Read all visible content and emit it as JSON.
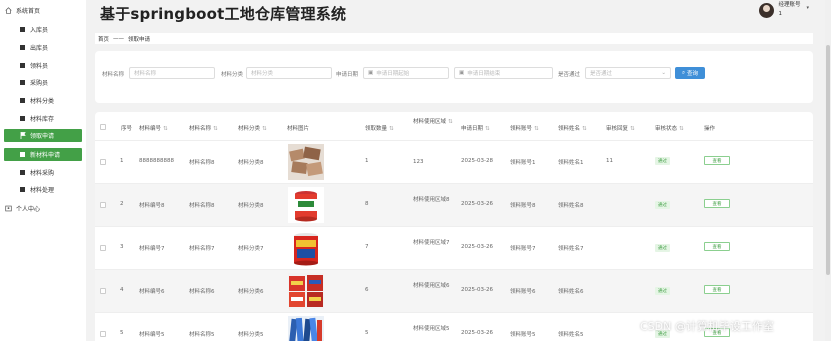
{
  "sidebar": {
    "items": [
      {
        "label": "系统首页",
        "icon": "home-icon",
        "type": "top"
      },
      {
        "label": "入库员",
        "icon": "square-icon",
        "type": "sub"
      },
      {
        "label": "出库员",
        "icon": "square-icon",
        "type": "sub"
      },
      {
        "label": "领料员",
        "icon": "square-icon",
        "type": "sub"
      },
      {
        "label": "采购员",
        "icon": "square-icon",
        "type": "sub"
      },
      {
        "label": "材料分类",
        "icon": "square-icon",
        "type": "sub"
      },
      {
        "label": "材料库存",
        "icon": "square-icon",
        "type": "sub"
      },
      {
        "label": "领取申请",
        "icon": "flag-icon",
        "type": "active"
      },
      {
        "label": "新材料申请",
        "icon": "square-icon",
        "type": "active"
      },
      {
        "label": "材料采购",
        "icon": "square-icon",
        "type": "sub"
      },
      {
        "label": "材料处理",
        "icon": "square-icon",
        "type": "sub"
      },
      {
        "label": "个人中心",
        "icon": "user-icon",
        "type": "top"
      }
    ]
  },
  "header": {
    "title": "基于springboot工地仓库管理系统",
    "user_name": "经理账号",
    "user_sub": "1"
  },
  "breadcrumb": {
    "home": "首页",
    "sep": "——",
    "current": "领取申请"
  },
  "filters": {
    "material_name_label": "材料名称",
    "material_name_placeholder": "材料名称",
    "category_label": "材料分类",
    "category_placeholder": "材料分类",
    "date_label": "申请日期",
    "date_start_placeholder": "申请日期起始",
    "date_end_placeholder": "申请日期结束",
    "pass_label": "是否通过",
    "pass_placeholder": "是否通过",
    "search_label": "查询"
  },
  "table": {
    "headers": [
      "序号",
      "材料编号",
      "材料名称",
      "材料分类",
      "材料图片",
      "领取数量",
      "材料使用区域",
      "申请日期",
      "领料账号",
      "领料姓名",
      "审核回复",
      "审核状态",
      "操作"
    ],
    "rows": [
      {
        "idx": "1",
        "code": "8888888888",
        "name": "材料名称8",
        "cat": "材料分类8",
        "qty": "1",
        "area": "123",
        "date": "2025-03-28",
        "acct": "领料账号1",
        "person": "领料姓名1",
        "reply": "11",
        "status": "通过",
        "action": "查看",
        "img": "tiles"
      },
      {
        "idx": "2",
        "code": "材料编号8",
        "name": "材料名称8",
        "cat": "材料分类8",
        "qty": "8",
        "area": "材料使用区域8",
        "date": "2025-03-26",
        "acct": "领料账号8",
        "person": "领料姓名8",
        "reply": "",
        "status": "通过",
        "action": "查看",
        "img": "bucket"
      },
      {
        "idx": "3",
        "code": "材料编号7",
        "name": "材料名称7",
        "cat": "材料分类7",
        "qty": "7",
        "area": "材料使用区域7",
        "date": "2025-03-26",
        "acct": "领料账号7",
        "person": "领料姓名7",
        "reply": "",
        "status": "通过",
        "action": "查看",
        "img": "bucket-red"
      },
      {
        "idx": "4",
        "code": "材料编号6",
        "name": "材料名称6",
        "cat": "材料分类6",
        "qty": "6",
        "area": "材料使用区域6",
        "date": "2025-03-26",
        "acct": "领料账号6",
        "person": "领料姓名6",
        "reply": "",
        "status": "通过",
        "action": "查看",
        "img": "buckets"
      },
      {
        "idx": "5",
        "code": "材料编号5",
        "name": "材料名称5",
        "cat": "材料分类5",
        "qty": "5",
        "area": "材料使用区域5",
        "date": "2025-03-26",
        "acct": "领料账号5",
        "person": "领料姓名5",
        "reply": "",
        "status": "通过",
        "action": "查看",
        "img": "rolls"
      }
    ]
  },
  "watermark": "CSDN @计算机毕设工作室",
  "colors": {
    "accent_green": "#43a047",
    "search_blue": "#3f8fd8"
  }
}
